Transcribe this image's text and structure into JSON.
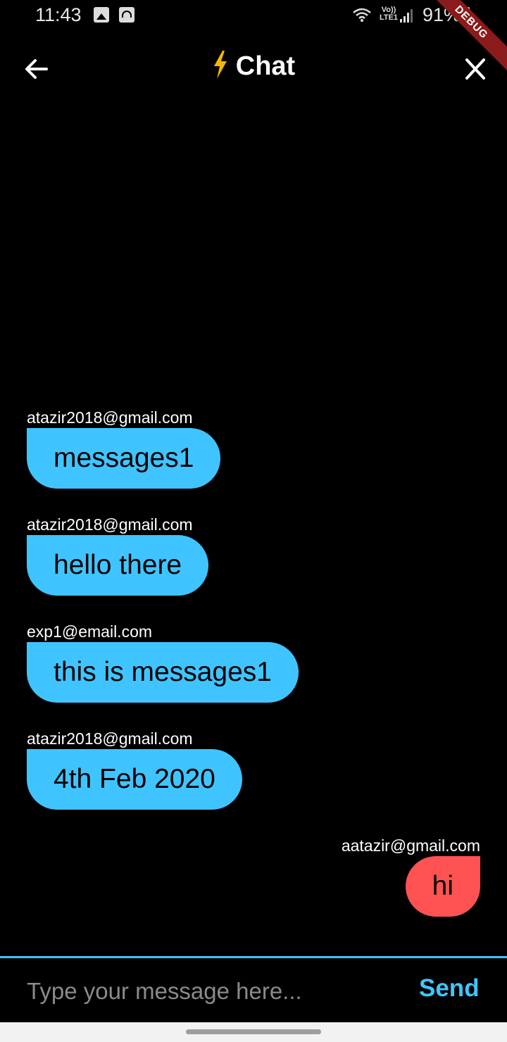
{
  "status_bar": {
    "time": "11:43",
    "network_label": "Vo)) LTE1",
    "battery": "91%"
  },
  "debug_banner": "DEBUG",
  "app_bar": {
    "title": "Chat",
    "title_icon": "lightning-bolt-icon",
    "back_icon": "arrow-left-icon",
    "close_icon": "close-icon"
  },
  "messages": [
    {
      "sender": "atazir2018@gmail.com",
      "text": "messages1",
      "side": "left"
    },
    {
      "sender": "atazir2018@gmail.com",
      "text": "hello there",
      "side": "left"
    },
    {
      "sender": "exp1@email.com",
      "text": "this is messages1",
      "side": "left"
    },
    {
      "sender": "atazir2018@gmail.com",
      "text": "4th Feb 2020",
      "side": "left"
    },
    {
      "sender": "aatazir@gmail.com",
      "text": "hi",
      "side": "right"
    }
  ],
  "composer": {
    "value": "",
    "placeholder": "Type your message here...",
    "send_label": "Send"
  },
  "colors": {
    "accent": "#40c4ff",
    "own_bubble": "#ff5252",
    "background": "#000000"
  }
}
